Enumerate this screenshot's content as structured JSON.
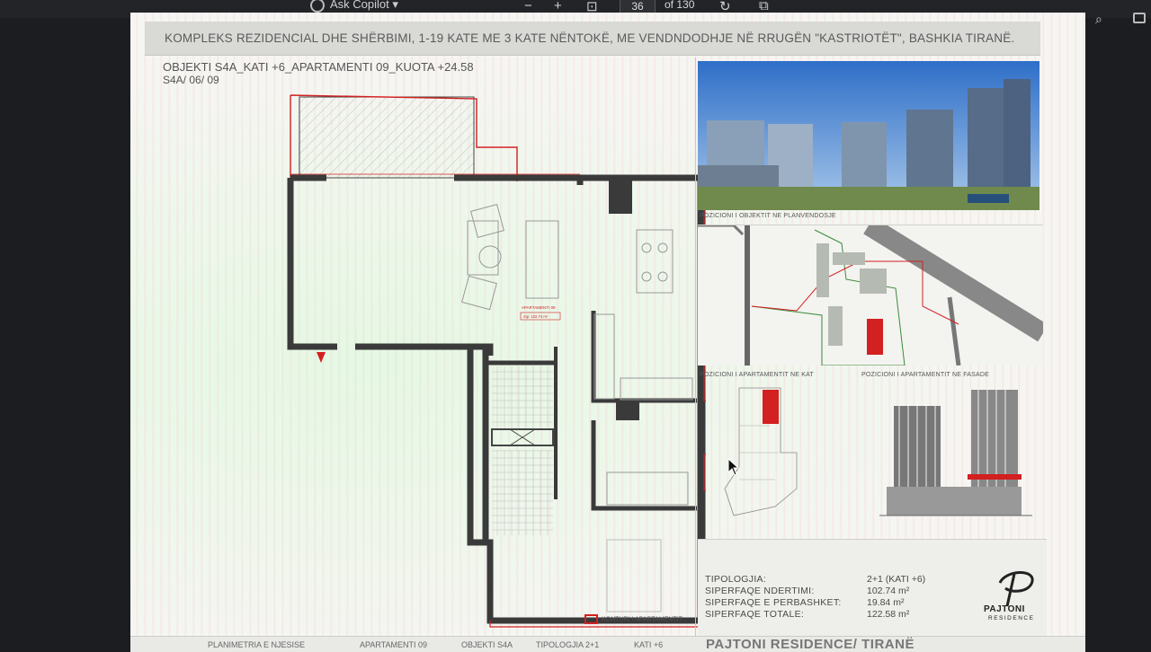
{
  "toolbar": {
    "copilot_label": "Ask Copilot",
    "page_current": "36",
    "page_total": "of 130"
  },
  "document": {
    "banner": "KOMPLEKS REZIDENCIAL  DHE SHËRBIMI, 1-19 KATE ME 3 KATE NËNTOKË, ME VENDNDODHJE NË RRUGËN \"KASTRIOTËT\", BASHKIA TIRANË.",
    "object_title": "OBJEKTI S4A_KATI +6_APARTAMENTI 09_KUOTA +24.58",
    "object_code": "S4A/ 06/ 09",
    "plan_label_name": "APARTAMENTI 09",
    "plan_label_area": "Sip: 102.74 m²",
    "captions": {
      "site": "POZICIONI I OBJEKTIT NE PLANVENDOSJE",
      "floor": "POZICIONI I APARTAMENTIT NE KAT",
      "facade": "POZICIONI I APARTAMENTIT NE FASADE"
    },
    "info": {
      "rows": [
        {
          "label": "TIPOLOGJIA:",
          "value": "2+1 (KATI +6)"
        },
        {
          "label": "SIPERFAQE  NDERTIMI:",
          "value": "102.74 m²"
        },
        {
          "label": "SIPERFAQE  E  PERBASHKET:",
          "value": "19.84 m²"
        },
        {
          "label": "SIPERFAQE  TOTALE:",
          "value": "122.58 m²"
        }
      ],
      "logo_name": "PAJTONI",
      "logo_sub": "RESIDENCE"
    },
    "legend": "KONTURI I APARTAMENTIT",
    "footer": {
      "f1": "PLANIMETRIA E NJESISE",
      "f2": "APARTAMENTI 09",
      "f3": "OBJEKTI S4A",
      "f4": "TIPOLOGJIA 2+1",
      "f5": "KATI +6",
      "f6": "PAJTONI RESIDENCE/ TIRANË"
    }
  },
  "colors": {
    "contour": "#d32020",
    "wall": "#3a3a3a",
    "banner_bg": "#d9d9d6"
  }
}
